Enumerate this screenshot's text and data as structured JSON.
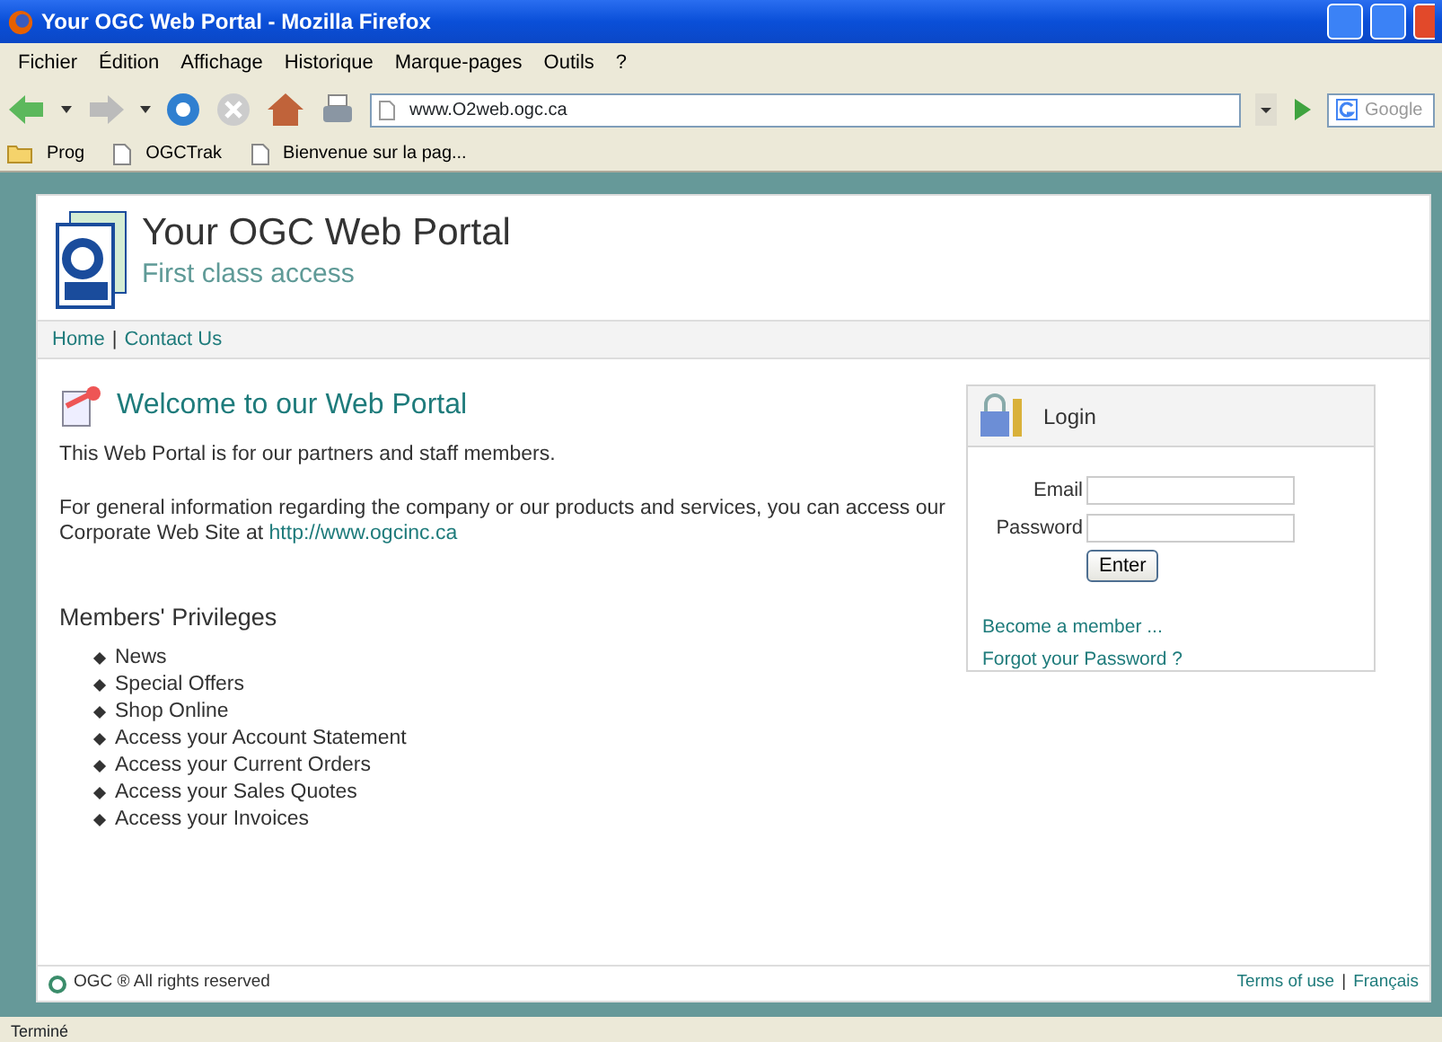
{
  "window": {
    "title": "Your OGC Web Portal - Mozilla Firefox"
  },
  "menu": [
    "Fichier",
    "Édition",
    "Affichage",
    "Historique",
    "Marque-pages",
    "Outils",
    "?"
  ],
  "toolbar": {
    "address": "www.O2web.ogc.ca",
    "search_placeholder": "Google"
  },
  "bookmarks": [
    {
      "label": "Prog",
      "kind": "folder"
    },
    {
      "label": "OGCTrak",
      "kind": "page"
    },
    {
      "label": "Bienvenue sur la pag...",
      "kind": "page"
    }
  ],
  "portal": {
    "title": "Your OGC Web Portal",
    "subtitle": "First class access",
    "nav": [
      "Home",
      "Contact Us"
    ],
    "nav_separator": "|",
    "welcome": {
      "heading": "Welcome to our Web Portal",
      "paragraphs": [
        {
          "text": "This Web Portal is for our partners and staff members."
        },
        {
          "text": "For general information regarding the company or our products and services, you can access our Corporate Web Site at",
          "link": "http://www.ogcinc.ca"
        }
      ]
    },
    "privileges": {
      "heading": "Members' Privileges",
      "items": [
        "News",
        "Special Offers",
        "Shop Online",
        "Access your Account Statement",
        "Access your Current Orders",
        "Access your Sales Quotes",
        "Access your Invoices"
      ]
    },
    "login": {
      "title": "Login",
      "fields": [
        {
          "label": "Email"
        },
        {
          "label": "Password"
        }
      ],
      "button": "Enter",
      "links": [
        "Become a member ...",
        "Forgot your Password ?"
      ]
    },
    "footer": {
      "copyright": "OGC ® All rights reserved",
      "links": [
        "Terms of use",
        "Français"
      ],
      "separator": "|"
    }
  },
  "status_bar": "Terminé"
}
